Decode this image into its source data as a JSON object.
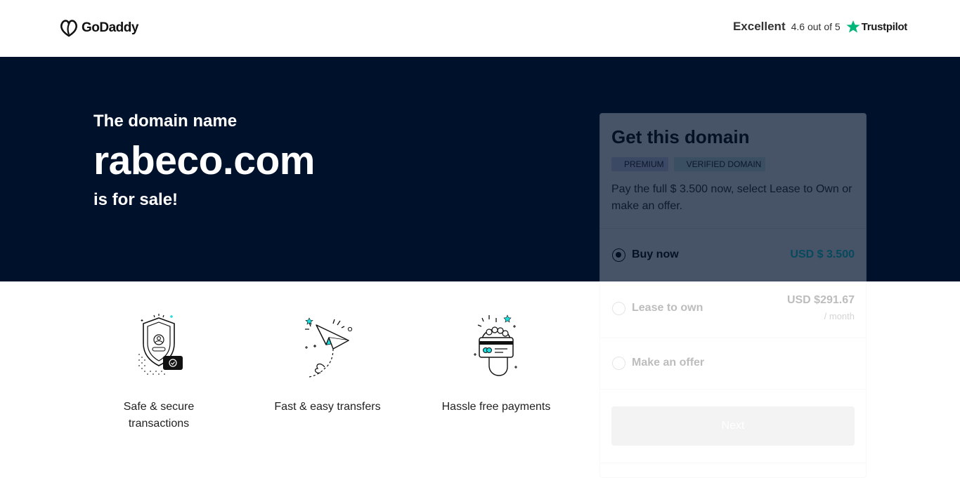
{
  "header": {
    "logo_text": "GoDaddy",
    "rating_word": "Excellent",
    "rating_score": "4.6 out of 5",
    "trustpilot_label": "Trustpilot"
  },
  "hero": {
    "pre_text": "The domain name",
    "domain": "rabeco.com",
    "post_text": "is for sale!"
  },
  "features": [
    {
      "label": "Safe & secure transactions",
      "icon": "shield-icon"
    },
    {
      "label": "Fast & easy transfers",
      "icon": "paper-plane-icon"
    },
    {
      "label": "Hassle free payments",
      "icon": "card-hand-icon"
    }
  ],
  "card": {
    "title": "Get this domain",
    "badges": [
      "PREMIUM",
      "VERIFIED DOMAIN"
    ],
    "description": "Pay the full $ 3.500 now, select Lease to Own or make an offer.",
    "options": [
      {
        "label": "Buy now",
        "price": "USD $ 3.500",
        "selected": true
      },
      {
        "label": "Lease to own",
        "price": "USD $291.67",
        "sub": "/ month",
        "selected": false
      },
      {
        "label": "Make an offer",
        "selected": false
      }
    ],
    "next_label": "Next"
  },
  "colors": {
    "hero_bg": "#00112c",
    "accent_teal": "#1bdbdb",
    "button_disabled": "#d4d4d4"
  }
}
